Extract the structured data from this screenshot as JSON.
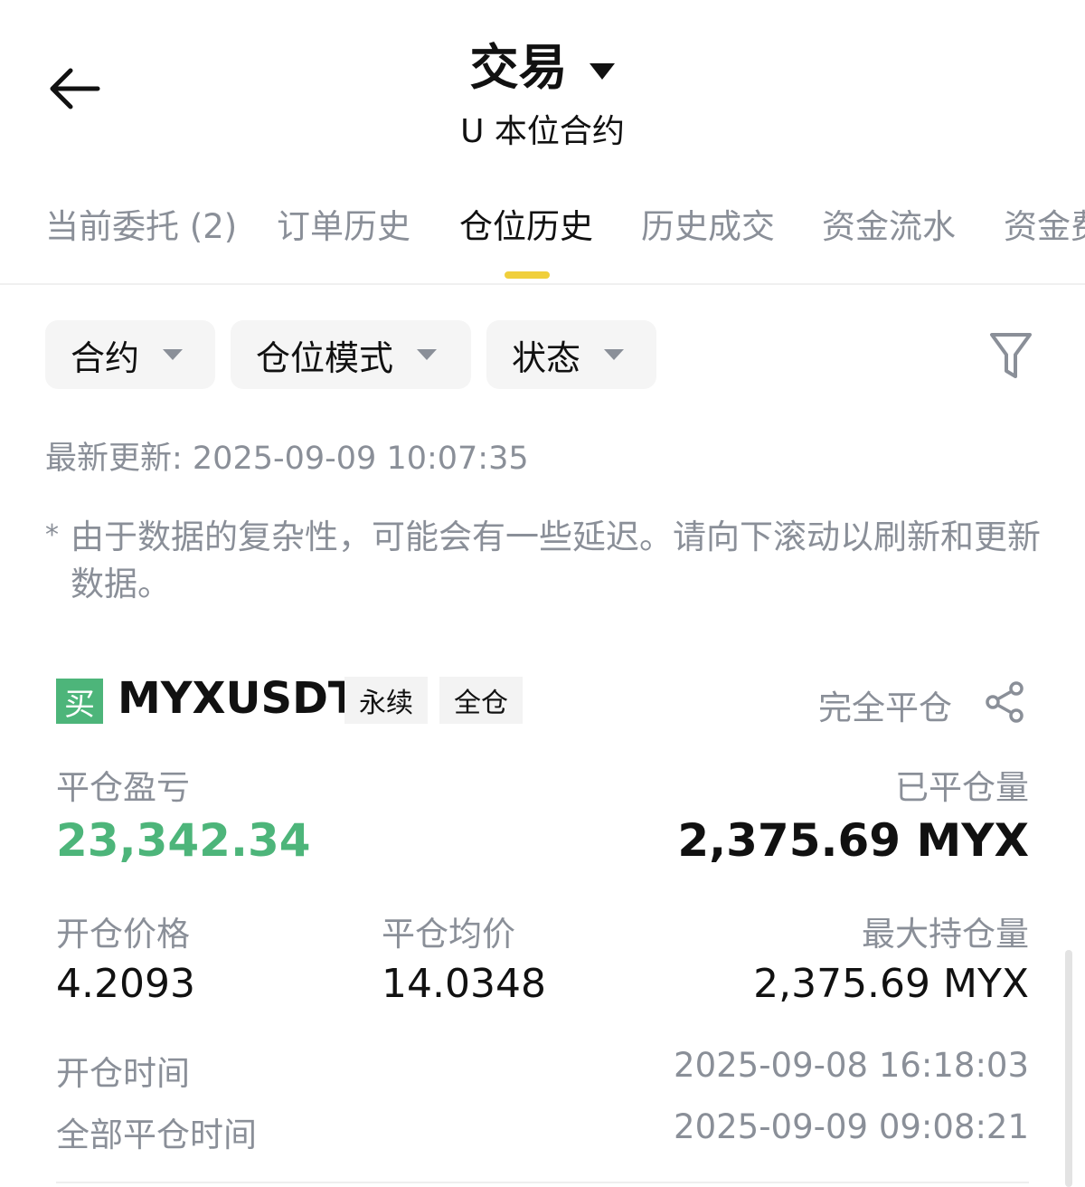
{
  "header": {
    "back_icon": "arrow-left-icon",
    "title": "交易",
    "subtitle": "U 本位合约"
  },
  "tabs": [
    {
      "label": "当前委托 (2)",
      "active": false
    },
    {
      "label": "订单历史",
      "active": false
    },
    {
      "label": "仓位历史",
      "active": true
    },
    {
      "label": "历史成交",
      "active": false
    },
    {
      "label": "资金流水",
      "active": false
    },
    {
      "label": "资金费",
      "active": false
    }
  ],
  "filters": {
    "contract": "合约",
    "position_mode": "仓位模式",
    "status": "状态",
    "filter_icon": "funnel-icon"
  },
  "updated": "最新更新: 2025-09-09 10:07:35",
  "note_star": "*",
  "note": "由于数据的复杂性，可能会有一些延迟。请向下滚动以刷新和更新数据。",
  "position": {
    "side": "买",
    "symbol": "MYXUSDT",
    "tag_perpetual": "永续",
    "tag_margin": "全仓",
    "status": "完全平仓",
    "share_icon": "share-icon",
    "pnl_label": "平仓盈亏",
    "pnl_value": "23,342.34",
    "closed_qty_label": "已平仓量",
    "closed_qty_value": "2,375.69 MYX",
    "open_price_label": "开仓价格",
    "open_price_value": "4.2093",
    "avg_close_label": "平仓均价",
    "avg_close_value": "14.0348",
    "max_pos_label": "最大持仓量",
    "max_pos_value": "2,375.69 MYX",
    "open_time_label": "开仓时间",
    "open_time_value": "2025-09-08 16:18:03",
    "close_time_label": "全部平仓时间",
    "close_time_value": "2025-09-09 09:08:21"
  },
  "colors": {
    "accent_yellow": "#f0cf3c",
    "profit_green": "#4db57a",
    "muted_text": "#8a8f98"
  }
}
